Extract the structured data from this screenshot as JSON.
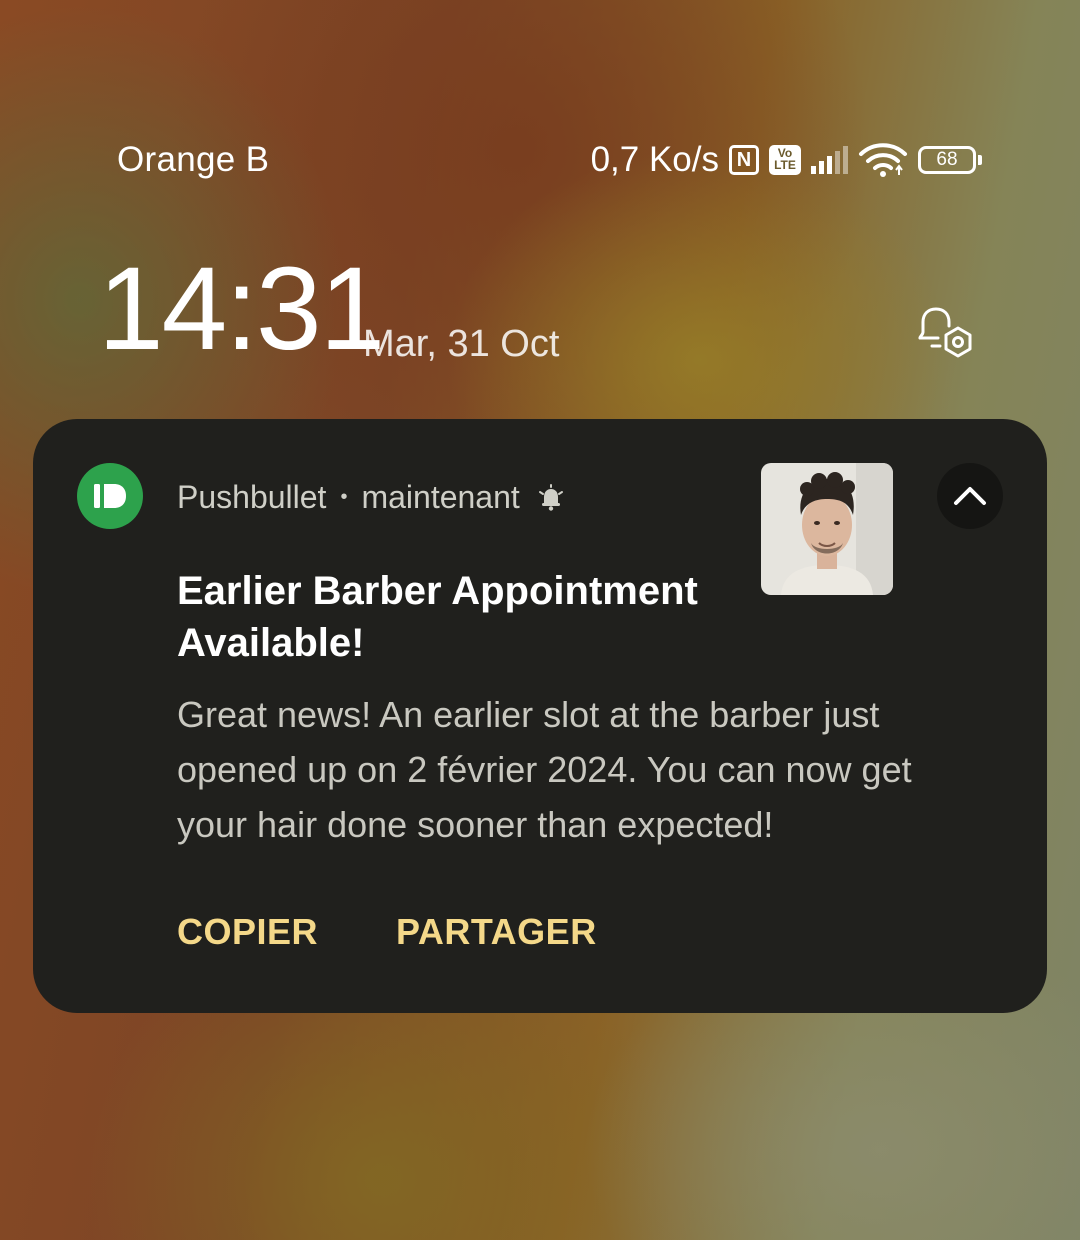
{
  "status_bar": {
    "carrier": "Orange B",
    "network_speed": "0,7 Ko/s",
    "nfc_icon": "nfc-icon",
    "volte_label": "Vo LTE",
    "signal_bars_filled": 3,
    "signal_bars_total": 5,
    "battery_level": "68"
  },
  "lockscreen": {
    "time": "14:31",
    "date": "Mar, 31 Oct"
  },
  "notification": {
    "app_name": "Pushbullet",
    "separator": "•",
    "timestamp": "maintenant",
    "title": "Earlier Barber Appointment Available!",
    "body": "Great news! An earlier slot at the barber just opened up on 2 février 2024. You can now get your hair done sooner than expected!",
    "actions": {
      "copy": "COPIER",
      "share": "PARTAGER"
    },
    "colors": {
      "app_icon": "#2da24c",
      "card_background": "#20201d",
      "action_text": "#f4d889"
    }
  }
}
